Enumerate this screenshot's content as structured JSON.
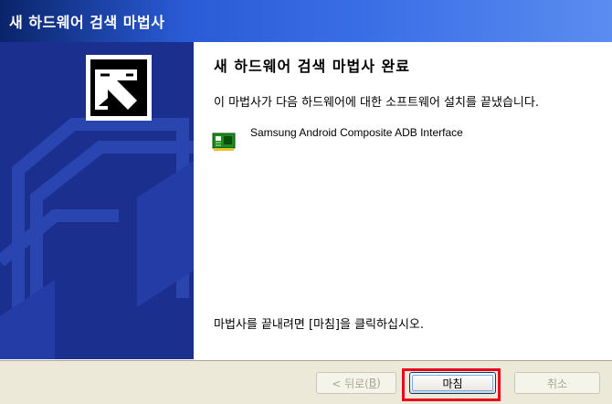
{
  "window": {
    "title": "새 하드웨어 검색 마법사"
  },
  "content": {
    "heading": "새 하드웨어 검색 마법사 완료",
    "description": "이 마법사가 다음 하드웨어에 대한 소프트웨어 설치를 끝냈습니다.",
    "device": {
      "name": "Samsung Android Composite ADB Interface",
      "icon": "pci-card-icon"
    },
    "finish_hint": "마법사를 끝내려면 [마침]을 클릭하십시오."
  },
  "buttons": {
    "back_label": "< 뒤로(",
    "back_key": "B",
    "back_close": ")",
    "finish_label": "마침",
    "cancel_label": "취소"
  },
  "colors": {
    "highlight": "#E8001C",
    "titlebar": "#2A5BD6",
    "sidebar": "#1B2F8F"
  }
}
